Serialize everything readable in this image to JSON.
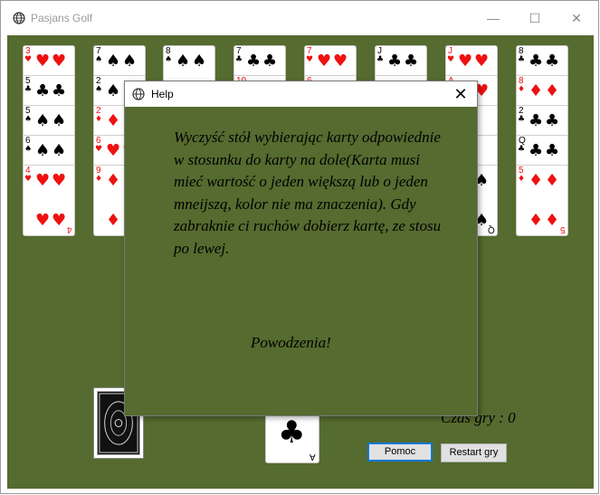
{
  "window": {
    "title": "Pasjans Golf",
    "minimize": "—",
    "maximize": "☐",
    "close": "✕"
  },
  "columns": [
    {
      "cards": [
        {
          "rank": "3",
          "suit": "♥",
          "color": "red"
        },
        {
          "rank": "5",
          "suit": "♣",
          "color": "black"
        },
        {
          "rank": "5",
          "suit": "♠",
          "color": "black"
        },
        {
          "rank": "6",
          "suit": "♠",
          "color": "black"
        },
        {
          "rank": "4",
          "suit": "♥",
          "color": "red"
        }
      ]
    },
    {
      "cards": [
        {
          "rank": "7",
          "suit": "♠",
          "color": "black"
        },
        {
          "rank": "2",
          "suit": "♠",
          "color": "black"
        },
        {
          "rank": "2",
          "suit": "♦",
          "color": "red"
        },
        {
          "rank": "6",
          "suit": "♥",
          "color": "red"
        },
        {
          "rank": "9",
          "suit": "♦",
          "color": "red"
        }
      ]
    },
    {
      "cards": [
        {
          "rank": "8",
          "suit": "♠",
          "color": "black"
        }
      ]
    },
    {
      "cards": [
        {
          "rank": "7",
          "suit": "♣",
          "color": "black"
        },
        {
          "rank": "10",
          "suit": "♥",
          "color": "red"
        }
      ]
    },
    {
      "cards": [
        {
          "rank": "7",
          "suit": "♥",
          "color": "red"
        },
        {
          "rank": "6",
          "suit": "♦",
          "color": "red"
        }
      ]
    },
    {
      "cards": [
        {
          "rank": "J",
          "suit": "♣",
          "color": "black"
        },
        {
          "rank": "",
          "suit": "",
          "color": "black"
        },
        {
          "rank": "",
          "suit": "",
          "color": "black"
        },
        {
          "rank": "",
          "suit": "",
          "color": "black"
        },
        {
          "rank": "",
          "suit": "",
          "color": "black"
        }
      ]
    },
    {
      "cards": [
        {
          "rank": "J",
          "suit": "♥",
          "color": "red"
        },
        {
          "rank": "A",
          "suit": "♥",
          "color": "red"
        },
        {
          "rank": "",
          "suit": "",
          "color": "black"
        },
        {
          "rank": "",
          "suit": "",
          "color": "black"
        },
        {
          "rank": "Q",
          "suit": "♠",
          "color": "black"
        }
      ]
    },
    {
      "cards": [
        {
          "rank": "8",
          "suit": "♣",
          "color": "black"
        },
        {
          "rank": "8",
          "suit": "♦",
          "color": "red"
        },
        {
          "rank": "2",
          "suit": "♣",
          "color": "black"
        },
        {
          "rank": "Q",
          "suit": "♣",
          "color": "black"
        },
        {
          "rank": "5",
          "suit": "♦",
          "color": "red"
        }
      ]
    }
  ],
  "deck": {
    "icon": "card-back"
  },
  "waste": {
    "rank": "A",
    "suit": "♣",
    "color": "black"
  },
  "timer": {
    "label": "Czas gry : 0"
  },
  "buttons": {
    "help": "Pomoc",
    "restart": "Restart gry"
  },
  "help_dialog": {
    "title": "Help",
    "close": "✕",
    "body": "Wyczyść stół wybierając karty odpowiednie w stosunku  do karty na dole(Karta musi mieć wartość o jeden większą lub o jeden mneijszą, kolor nie ma znaczenia). Gdy zabraknie ci ruchów dobierz kartę, ze stosu po lewej.",
    "wish": "Powodzenia!"
  },
  "colors": {
    "felt": "#556b2f",
    "red": "#e11111",
    "accent": "#0078d7"
  }
}
